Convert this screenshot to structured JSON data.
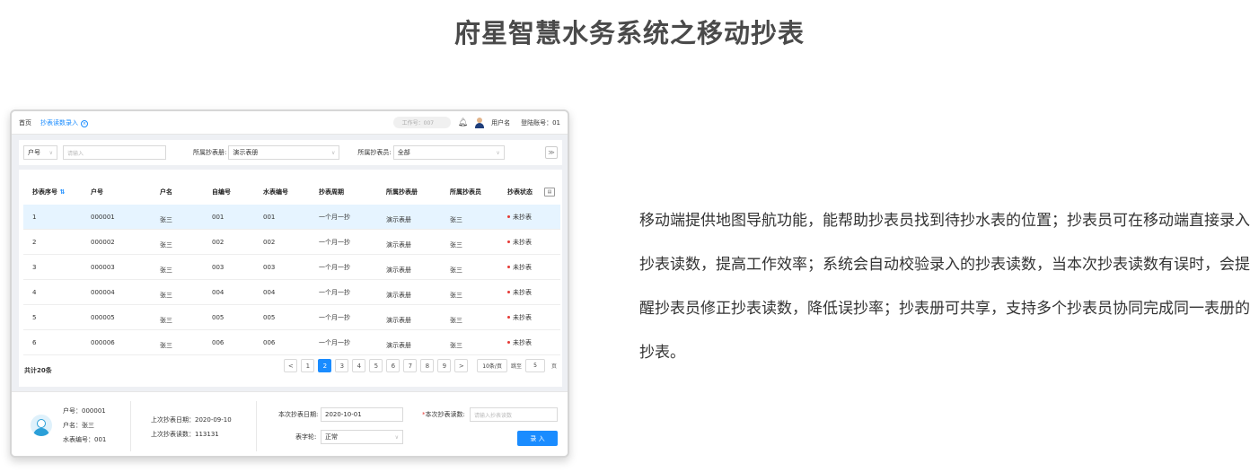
{
  "page_title": "府星智慧水务系统之移动抄表",
  "description": "移动端提供地图导航功能，能帮助抄表员找到待抄水表的位置；抄表员可在移动端直接录入抄表读数，提高工作效率；系统会自动校验录入的抄表读数，当本次抄表读数有误时，会提醒抄表员修正抄表读数，降低误抄率；抄表册可共享，支持多个抄表员协同完成同一表册的抄表。",
  "app": {
    "tabs": [
      {
        "label": "首页"
      },
      {
        "label": "抄表读数录入"
      }
    ],
    "workspace_pill": "工作号：007",
    "user_name": "用户名",
    "login_account": "登陆账号：01",
    "filter": {
      "field_select": "户号",
      "search_placeholder": "请输入",
      "book_label": "所属抄表册:",
      "book_value": "演示表册",
      "reader_label": "所属抄表员:",
      "reader_value": "全部"
    },
    "table": {
      "headers": [
        "抄表序号",
        "户号",
        "户名",
        "自编号",
        "水表编号",
        "抄表周期",
        "所属抄表册",
        "所属抄表员",
        "抄表状态"
      ],
      "sort_indicator": "⇅",
      "rows": [
        {
          "seq": "1",
          "account": "000001",
          "name": "张三",
          "self_no": "001",
          "meter_no": "001",
          "cycle": "一个月一抄",
          "book": "演示表册",
          "reader": "张三",
          "status": "未抄表"
        },
        {
          "seq": "2",
          "account": "000002",
          "name": "张三",
          "self_no": "002",
          "meter_no": "002",
          "cycle": "一个月一抄",
          "book": "演示表册",
          "reader": "张三",
          "status": "未抄表"
        },
        {
          "seq": "3",
          "account": "000003",
          "name": "张三",
          "self_no": "003",
          "meter_no": "003",
          "cycle": "一个月一抄",
          "book": "演示表册",
          "reader": "张三",
          "status": "未抄表"
        },
        {
          "seq": "4",
          "account": "000004",
          "name": "张三",
          "self_no": "004",
          "meter_no": "004",
          "cycle": "一个月一抄",
          "book": "演示表册",
          "reader": "张三",
          "status": "未抄表"
        },
        {
          "seq": "5",
          "account": "000005",
          "name": "张三",
          "self_no": "005",
          "meter_no": "005",
          "cycle": "一个月一抄",
          "book": "演示表册",
          "reader": "张三",
          "status": "未抄表"
        },
        {
          "seq": "6",
          "account": "000006",
          "name": "张三",
          "self_no": "006",
          "meter_no": "006",
          "cycle": "一个月一抄",
          "book": "演示表册",
          "reader": "张三",
          "status": "未抄表"
        }
      ]
    },
    "total_label": "共计20条",
    "pager": {
      "prev": "<",
      "pages": [
        "1",
        "2",
        "3",
        "4",
        "5",
        "6",
        "7",
        "8",
        "9"
      ],
      "next": ">",
      "active_page": "2",
      "page_size": "10条/页",
      "jump_label": "跳至",
      "jump_value": "5",
      "page_unit": "页"
    },
    "entry": {
      "account": "户号：000001",
      "name": "户名：张三",
      "meter": "水表编号：001",
      "last_date": "上次抄表日期：2020-09-10",
      "last_reading": "上次抄表读数：113131",
      "date_label": "本次抄表日期:",
      "date_value": "2020-10-01",
      "dial_label": "表字轮:",
      "dial_value": "正常",
      "reading_label": "本次抄表读数:",
      "reading_placeholder": "请输入抄表读数",
      "submit_label": "录 入"
    },
    "colors": {
      "primary": "#1a8cff",
      "status_dot": "#e53935",
      "highlight_row": "#e6f4ff"
    }
  }
}
